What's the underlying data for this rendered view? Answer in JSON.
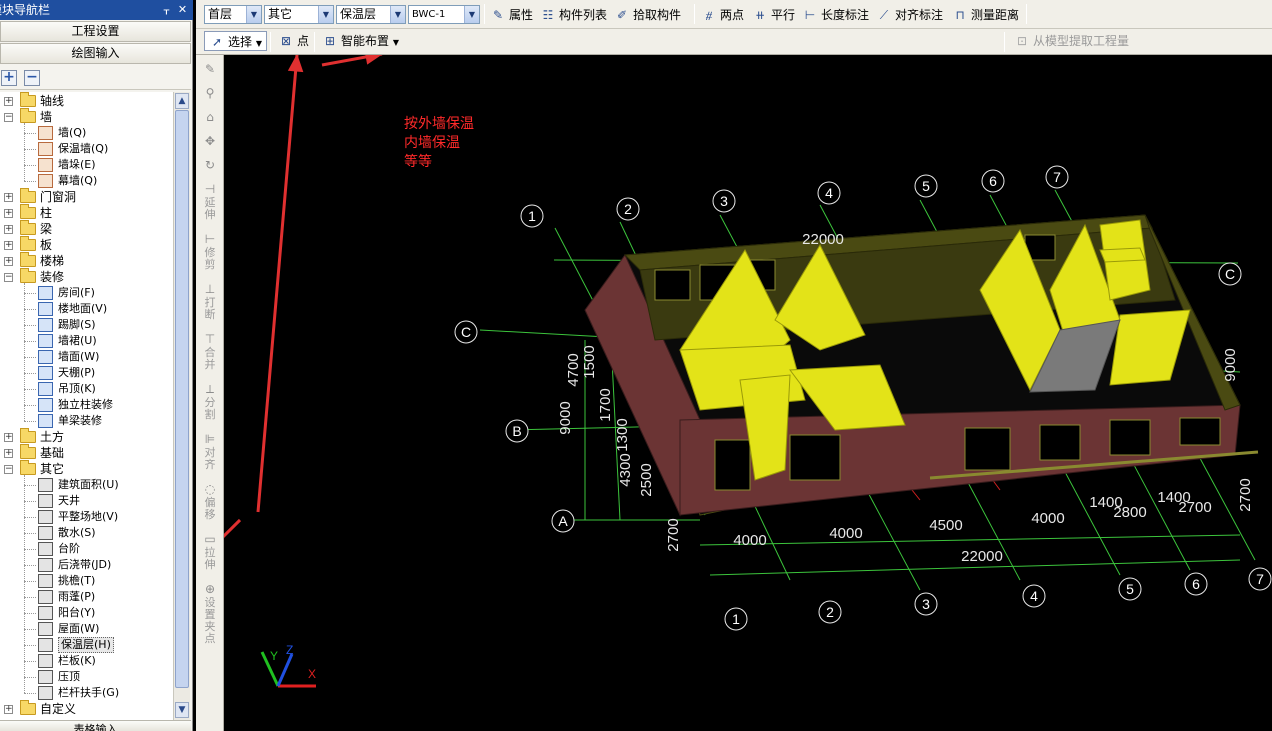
{
  "nav": {
    "title": "模块导航栏",
    "pin_glyph": "ᚁ",
    "close_glyph": "✕",
    "btn_project": "工程设置",
    "btn_draw": "绘图输入",
    "add_glyph": "+",
    "remove_glyph": "−",
    "bottom_label": "表格输入",
    "tree": [
      {
        "label": "轴线",
        "depth": 0,
        "kind": "folder",
        "expanded": false
      },
      {
        "label": "墙",
        "depth": 0,
        "kind": "folder",
        "expanded": true
      },
      {
        "label": "墙(Q)",
        "depth": 1,
        "kind": "item"
      },
      {
        "label": "保温墙(Q)",
        "depth": 1,
        "kind": "item"
      },
      {
        "label": "墙垛(E)",
        "depth": 1,
        "kind": "item"
      },
      {
        "label": "幕墙(Q)",
        "depth": 1,
        "kind": "item"
      },
      {
        "label": "门窗洞",
        "depth": 0,
        "kind": "folder",
        "expanded": false
      },
      {
        "label": "柱",
        "depth": 0,
        "kind": "folder",
        "expanded": false
      },
      {
        "label": "梁",
        "depth": 0,
        "kind": "folder",
        "expanded": false
      },
      {
        "label": "板",
        "depth": 0,
        "kind": "folder",
        "expanded": false
      },
      {
        "label": "楼梯",
        "depth": 0,
        "kind": "folder",
        "expanded": false
      },
      {
        "label": "装修",
        "depth": 0,
        "kind": "folder",
        "expanded": true
      },
      {
        "label": "房间(F)",
        "depth": 1,
        "kind": "item",
        "tone": "blue"
      },
      {
        "label": "楼地面(V)",
        "depth": 1,
        "kind": "item",
        "tone": "blue"
      },
      {
        "label": "踢脚(S)",
        "depth": 1,
        "kind": "item",
        "tone": "blue"
      },
      {
        "label": "墙裙(U)",
        "depth": 1,
        "kind": "item",
        "tone": "blue"
      },
      {
        "label": "墙面(W)",
        "depth": 1,
        "kind": "item",
        "tone": "blue"
      },
      {
        "label": "天棚(P)",
        "depth": 1,
        "kind": "item",
        "tone": "blue"
      },
      {
        "label": "吊顶(K)",
        "depth": 1,
        "kind": "item",
        "tone": "blue"
      },
      {
        "label": "独立柱装修",
        "depth": 1,
        "kind": "item",
        "tone": "blue"
      },
      {
        "label": "单梁装修",
        "depth": 1,
        "kind": "item",
        "tone": "blue"
      },
      {
        "label": "土方",
        "depth": 0,
        "kind": "folder",
        "expanded": false
      },
      {
        "label": "基础",
        "depth": 0,
        "kind": "folder",
        "expanded": false
      },
      {
        "label": "其它",
        "depth": 0,
        "kind": "folder",
        "expanded": true
      },
      {
        "label": "建筑面积(U)",
        "depth": 1,
        "kind": "item",
        "tone": "gray"
      },
      {
        "label": "天井",
        "depth": 1,
        "kind": "item",
        "tone": "gray"
      },
      {
        "label": "平整场地(V)",
        "depth": 1,
        "kind": "item",
        "tone": "gray"
      },
      {
        "label": "散水(S)",
        "depth": 1,
        "kind": "item",
        "tone": "gray"
      },
      {
        "label": "台阶",
        "depth": 1,
        "kind": "item",
        "tone": "gray"
      },
      {
        "label": "后浇带(JD)",
        "depth": 1,
        "kind": "item",
        "tone": "gray"
      },
      {
        "label": "挑檐(T)",
        "depth": 1,
        "kind": "item",
        "tone": "gray"
      },
      {
        "label": "雨蓬(P)",
        "depth": 1,
        "kind": "item",
        "tone": "gray"
      },
      {
        "label": "阳台(Y)",
        "depth": 1,
        "kind": "item",
        "tone": "gray"
      },
      {
        "label": "屋面(W)",
        "depth": 1,
        "kind": "item",
        "tone": "gray"
      },
      {
        "label": "保温层(H)",
        "depth": 1,
        "kind": "item",
        "tone": "gray",
        "selected": true
      },
      {
        "label": "栏板(K)",
        "depth": 1,
        "kind": "item",
        "tone": "gray"
      },
      {
        "label": "压顶",
        "depth": 1,
        "kind": "item",
        "tone": "gray"
      },
      {
        "label": "栏杆扶手(G)",
        "depth": 1,
        "kind": "item",
        "tone": "gray"
      },
      {
        "label": "自定义",
        "depth": 0,
        "kind": "folder",
        "expanded": false
      }
    ]
  },
  "toolbar1": {
    "floor": "首层",
    "category": "其它",
    "type": "保温层",
    "component": "BWC-1",
    "attr": "属性",
    "list": "构件列表",
    "pick": "拾取构件",
    "twopoint": "两点",
    "parallel": "平行",
    "length_dim": "长度标注",
    "align_dim": "对齐标注",
    "measure": "测量距离"
  },
  "toolbar2": {
    "select": "选择",
    "point": "点",
    "smart": "智能布置",
    "extract": "从模型提取工程量"
  },
  "vtools": [
    {
      "glyph": "✎",
      "label": ""
    },
    {
      "glyph": "⚲",
      "label": ""
    },
    {
      "glyph": "⌂",
      "label": ""
    },
    {
      "glyph": "✥",
      "label": ""
    },
    {
      "glyph": "↻",
      "label": ""
    },
    {
      "glyph": "⊣",
      "label": "延伸"
    },
    {
      "glyph": "⊢",
      "label": "修剪"
    },
    {
      "glyph": "⊥",
      "label": "打断"
    },
    {
      "glyph": "⊤",
      "label": "合并"
    },
    {
      "glyph": "⟂",
      "label": "分割"
    },
    {
      "glyph": "⊫",
      "label": "对齐"
    },
    {
      "glyph": "◌",
      "label": "偏移"
    },
    {
      "glyph": "▭",
      "label": "拉伸"
    },
    {
      "glyph": "⊕",
      "label": "设置夹点"
    }
  ],
  "canvas": {
    "note_lines": [
      "按外墙保温",
      "内墙保温",
      "等等"
    ],
    "axis_x": "X",
    "axis_y": "Y",
    "axis_z": "Z",
    "colors": {
      "wall_outer": "#6b3434",
      "wall_top": "#4a4a12",
      "inner": "#e3e318",
      "grid": "#3cc43c",
      "redline": "#d02020",
      "arrow": "#e03030"
    },
    "labels": [
      "1",
      "2",
      "3",
      "4",
      "5",
      "6",
      "7",
      "1",
      "2",
      "3",
      "4",
      "5",
      "6",
      "7",
      "A",
      "B",
      "C",
      "C"
    ],
    "dims": [
      "22000",
      "4000",
      "4000",
      "4500",
      "4000",
      "2800",
      "2700",
      "1400",
      "1400",
      "22000",
      "9000",
      "4700",
      "1500",
      "1700",
      "1300",
      "4300",
      "2500",
      "2700",
      "2700",
      "9000"
    ]
  }
}
